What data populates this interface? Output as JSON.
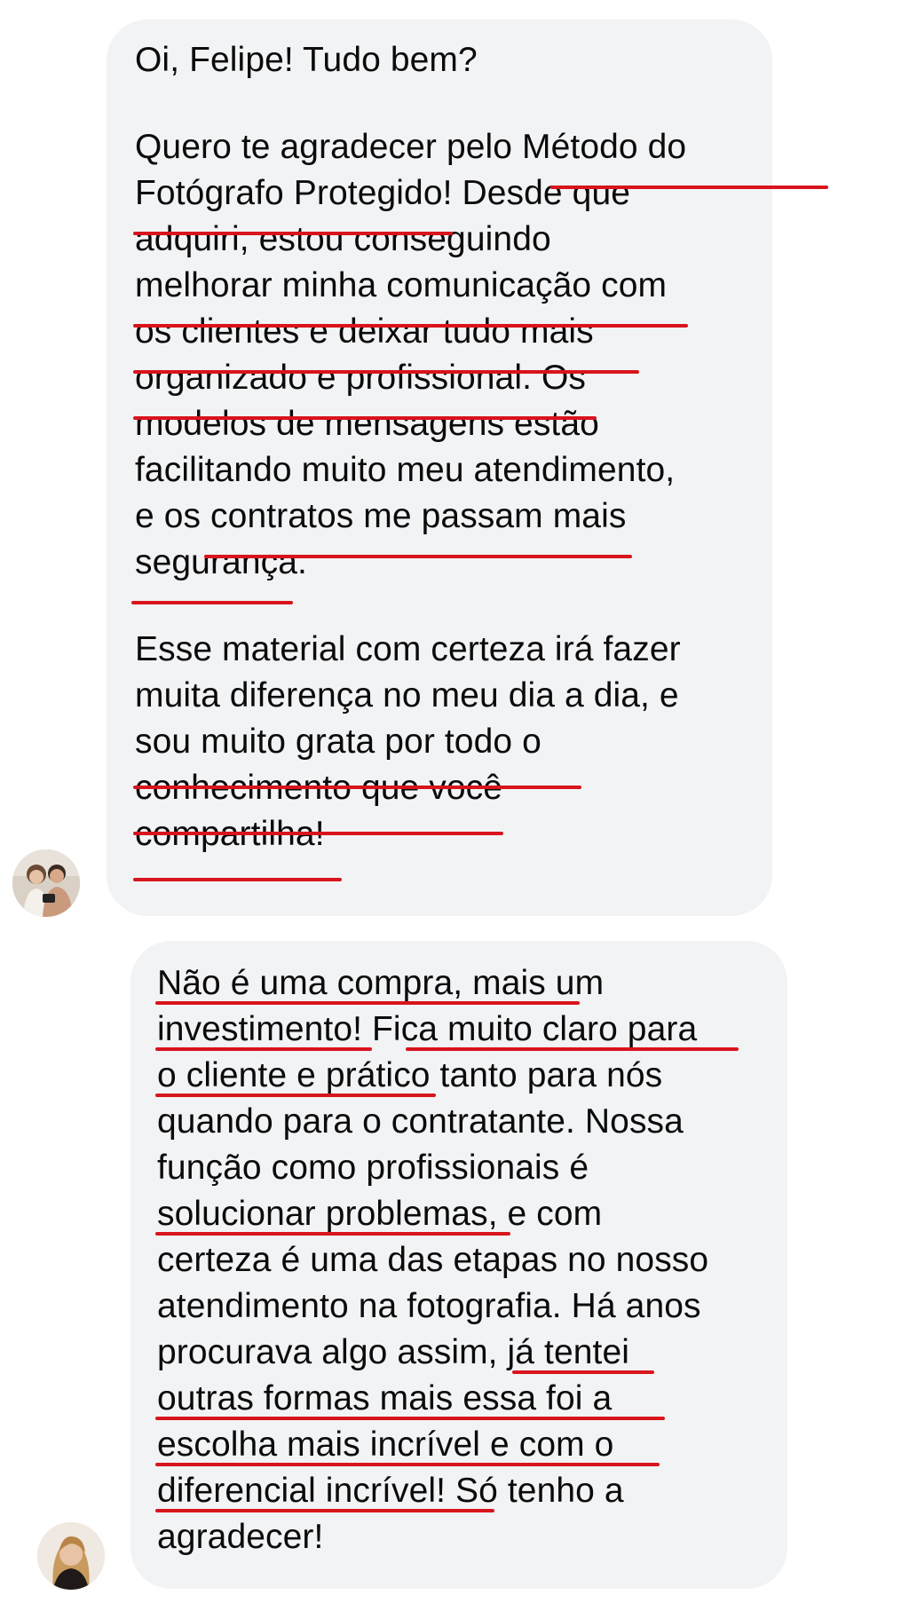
{
  "messages": [
    {
      "lines": [
        "Oi, Felipe! Tudo bem?",
        "",
        "Quero te agradecer pelo Método do",
        "Fotógrafo Protegido! Desde que",
        "adquiri, estou conseguindo",
        "melhorar minha comunicação com",
        "os clientes e deixar tudo mais",
        "organizado e profissional. Os",
        "modelos de mensagens estão",
        "facilitando muito meu atendimento,",
        "e os contratos me passam mais",
        "segurança.",
        "",
        "Esse material com certeza irá fazer",
        "muita diferença no meu dia a dia, e",
        "sou muito grata por todo o",
        "conhecimento que você",
        "compartilha!"
      ],
      "avatar_icon": "avatar-couple-photo"
    },
    {
      "lines": [
        "Não é uma compra, mais um",
        "investimento! Fica muito claro para",
        "o cliente e prático tanto para nós",
        "quando para o contratante. Nossa",
        "função como profissionais é",
        "solucionar problemas, e com",
        "certeza é uma das etapas no nosso",
        "atendimento na fotografia. Há anos",
        "procurava algo assim, já tentei",
        "outras formas mais essa foi a",
        "escolha mais incrível e com o",
        "diferencial incrível! Só tenho a",
        "agradecer!"
      ],
      "avatar_icon": "avatar-woman-photo"
    }
  ],
  "colors": {
    "bubble_background": "#f2f3f5",
    "underline_red": "#d8141c",
    "text": "#0b0b0b"
  }
}
